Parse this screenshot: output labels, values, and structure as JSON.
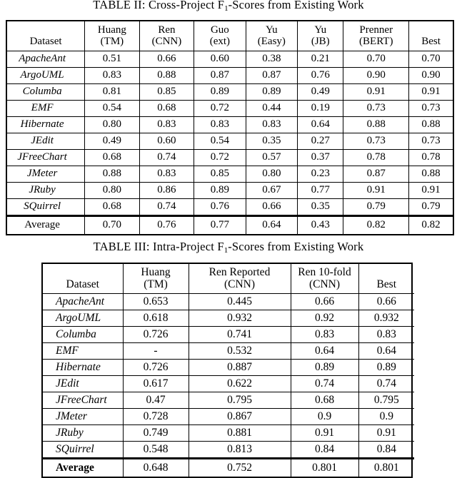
{
  "tables": [
    {
      "id": "table-2",
      "caption_prefix": "TABLE II:  Cross-Project F",
      "caption_sub": "1",
      "caption_suffix": "-Scores from Existing Work",
      "columns": [
        {
          "line1": "",
          "line2": "Dataset"
        },
        {
          "line1": "Huang",
          "line2": "(TM)"
        },
        {
          "line1": "Ren",
          "line2": "(CNN)"
        },
        {
          "line1": "Guo",
          "line2": "(ext)"
        },
        {
          "line1": "Yu",
          "line2": "(Easy)"
        },
        {
          "line1": "Yu",
          "line2": "(JB)"
        },
        {
          "line1": "Prenner",
          "line2": "(BERT)"
        },
        {
          "line1": "",
          "line2": "Best"
        }
      ],
      "rows": [
        {
          "dataset": "ApacheAnt",
          "values": [
            "0.51",
            "0.66",
            "0.60",
            "0.38",
            "0.21",
            "0.70",
            "0.70"
          ],
          "bold": [
            false,
            false,
            false,
            false,
            false,
            true,
            false
          ]
        },
        {
          "dataset": "ArgoUML",
          "values": [
            "0.83",
            "0.88",
            "0.87",
            "0.87",
            "0.76",
            "0.90",
            "0.90"
          ],
          "bold": [
            false,
            false,
            false,
            false,
            false,
            true,
            false
          ]
        },
        {
          "dataset": "Columba",
          "values": [
            "0.81",
            "0.85",
            "0.89",
            "0.89",
            "0.49",
            "0.91",
            "0.91"
          ],
          "bold": [
            false,
            false,
            false,
            false,
            false,
            true,
            false
          ]
        },
        {
          "dataset": "EMF",
          "values": [
            "0.54",
            "0.68",
            "0.72",
            "0.44",
            "0.19",
            "0.73",
            "0.73"
          ],
          "bold": [
            false,
            false,
            false,
            false,
            false,
            true,
            false
          ]
        },
        {
          "dataset": "Hibernate",
          "values": [
            "0.80",
            "0.83",
            "0.83",
            "0.83",
            "0.64",
            "0.88",
            "0.88"
          ],
          "bold": [
            false,
            false,
            false,
            false,
            false,
            true,
            false
          ]
        },
        {
          "dataset": "JEdit",
          "values": [
            "0.49",
            "0.60",
            "0.54",
            "0.35",
            "0.27",
            "0.73",
            "0.73"
          ],
          "bold": [
            false,
            false,
            false,
            false,
            false,
            true,
            false
          ]
        },
        {
          "dataset": "JFreeChart",
          "values": [
            "0.68",
            "0.74",
            "0.72",
            "0.57",
            "0.37",
            "0.78",
            "0.78"
          ],
          "bold": [
            false,
            false,
            false,
            false,
            false,
            true,
            false
          ]
        },
        {
          "dataset": "JMeter",
          "values": [
            "0.88",
            "0.83",
            "0.85",
            "0.80",
            "0.23",
            "0.87",
            "0.88"
          ],
          "bold": [
            true,
            false,
            false,
            false,
            false,
            false,
            false
          ]
        },
        {
          "dataset": "JRuby",
          "values": [
            "0.80",
            "0.86",
            "0.89",
            "0.67",
            "0.77",
            "0.91",
            "0.91"
          ],
          "bold": [
            false,
            false,
            false,
            false,
            false,
            true,
            false
          ]
        },
        {
          "dataset": "SQuirrel",
          "values": [
            "0.68",
            "0.74",
            "0.76",
            "0.66",
            "0.35",
            "0.79",
            "0.79"
          ],
          "bold": [
            false,
            false,
            false,
            false,
            false,
            true,
            false
          ]
        }
      ],
      "average": {
        "label": "Average",
        "label_bold": false,
        "values": [
          "0.70",
          "0.76",
          "0.77",
          "0.64",
          "0.43",
          "0.82",
          "0.82"
        ],
        "bold": [
          false,
          false,
          false,
          false,
          false,
          true,
          false
        ]
      }
    },
    {
      "id": "table-3",
      "caption_prefix": "TABLE III:  Intra-Project F",
      "caption_sub": "1",
      "caption_suffix": "-Scores from Existing Work",
      "columns": [
        {
          "line1": "",
          "line2": "Dataset"
        },
        {
          "line1": "Huang",
          "line2": "(TM)"
        },
        {
          "line1": "Ren Reported",
          "line2": "(CNN)"
        },
        {
          "line1": "Ren 10-fold",
          "line2": "(CNN)"
        },
        {
          "line1": "",
          "line2": "Best"
        }
      ],
      "rows": [
        {
          "dataset": "ApacheAnt",
          "values": [
            "0.653",
            "0.445",
            "0.66",
            "0.66"
          ],
          "bold": [
            false,
            false,
            true,
            false
          ]
        },
        {
          "dataset": "ArgoUML",
          "values": [
            "0.618",
            "0.932",
            "0.92",
            "0.932"
          ],
          "bold": [
            false,
            true,
            false,
            false
          ]
        },
        {
          "dataset": "Columba",
          "values": [
            "0.726",
            "0.741",
            "0.83",
            "0.83"
          ],
          "bold": [
            false,
            false,
            true,
            false
          ]
        },
        {
          "dataset": "EMF",
          "values": [
            "-",
            "0.532",
            "0.64",
            "0.64"
          ],
          "bold": [
            false,
            false,
            true,
            false
          ]
        },
        {
          "dataset": "Hibernate",
          "values": [
            "0.726",
            "0.887",
            "0.89",
            "0.89"
          ],
          "bold": [
            false,
            false,
            true,
            false
          ]
        },
        {
          "dataset": "JEdit",
          "values": [
            "0.617",
            "0.622",
            "0.74",
            "0.74"
          ],
          "bold": [
            false,
            false,
            true,
            false
          ]
        },
        {
          "dataset": "JFreeChart",
          "values": [
            "0.47",
            "0.795",
            "0.68",
            "0.795"
          ],
          "bold": [
            false,
            true,
            false,
            false
          ]
        },
        {
          "dataset": "JMeter",
          "values": [
            "0.728",
            "0.867",
            "0.9",
            "0.9"
          ],
          "bold": [
            false,
            false,
            true,
            false
          ]
        },
        {
          "dataset": "JRuby",
          "values": [
            "0.749",
            "0.881",
            "0.91",
            "0.91"
          ],
          "bold": [
            false,
            false,
            true,
            false
          ]
        },
        {
          "dataset": "SQuirrel",
          "values": [
            "0.548",
            "0.813",
            "0.84",
            "0.84"
          ],
          "bold": [
            false,
            false,
            true,
            false
          ]
        }
      ],
      "average": {
        "label": "Average",
        "label_bold": true,
        "values": [
          "0.648",
          "0.752",
          "0.801",
          "0.801"
        ],
        "bold": [
          false,
          false,
          true,
          false
        ]
      }
    }
  ]
}
